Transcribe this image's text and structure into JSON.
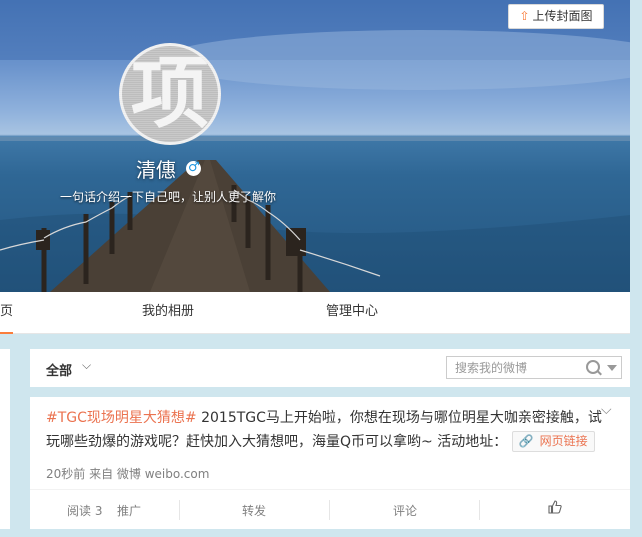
{
  "cover": {
    "upload_label": "上传封面图",
    "upload_icon": "upload-icon"
  },
  "profile": {
    "avatar_char": "项",
    "name": "清僡",
    "gender_symbol": "♂",
    "bio": "一句话介绍一下自己吧，让别人更了解你"
  },
  "nav": {
    "items": [
      "页",
      "我的相册",
      "管理中心"
    ]
  },
  "filter": {
    "all_label": "全部",
    "chevron": "⌵",
    "search_placeholder": "搜索我的微博"
  },
  "post": {
    "topic": "#TGC现场明星大猜想#",
    "text": " 2015TGC马上开始啦，你想在现场与哪位明星大咖亲密接触，试玩哪些劲爆的游戏呢？赶快加入大猜想吧，海量Q币可以拿哟~ 活动地址：",
    "link_label": "网页链接",
    "meta": "20秒前 来自 微博 weibo.com",
    "actions": {
      "read": "阅读 3",
      "promote": "推广",
      "forward": "转发",
      "comment": "评论"
    }
  },
  "colors": {
    "accent": "#fa7d3c",
    "topic": "#eb7350",
    "link_blue": "#1b95e0"
  }
}
